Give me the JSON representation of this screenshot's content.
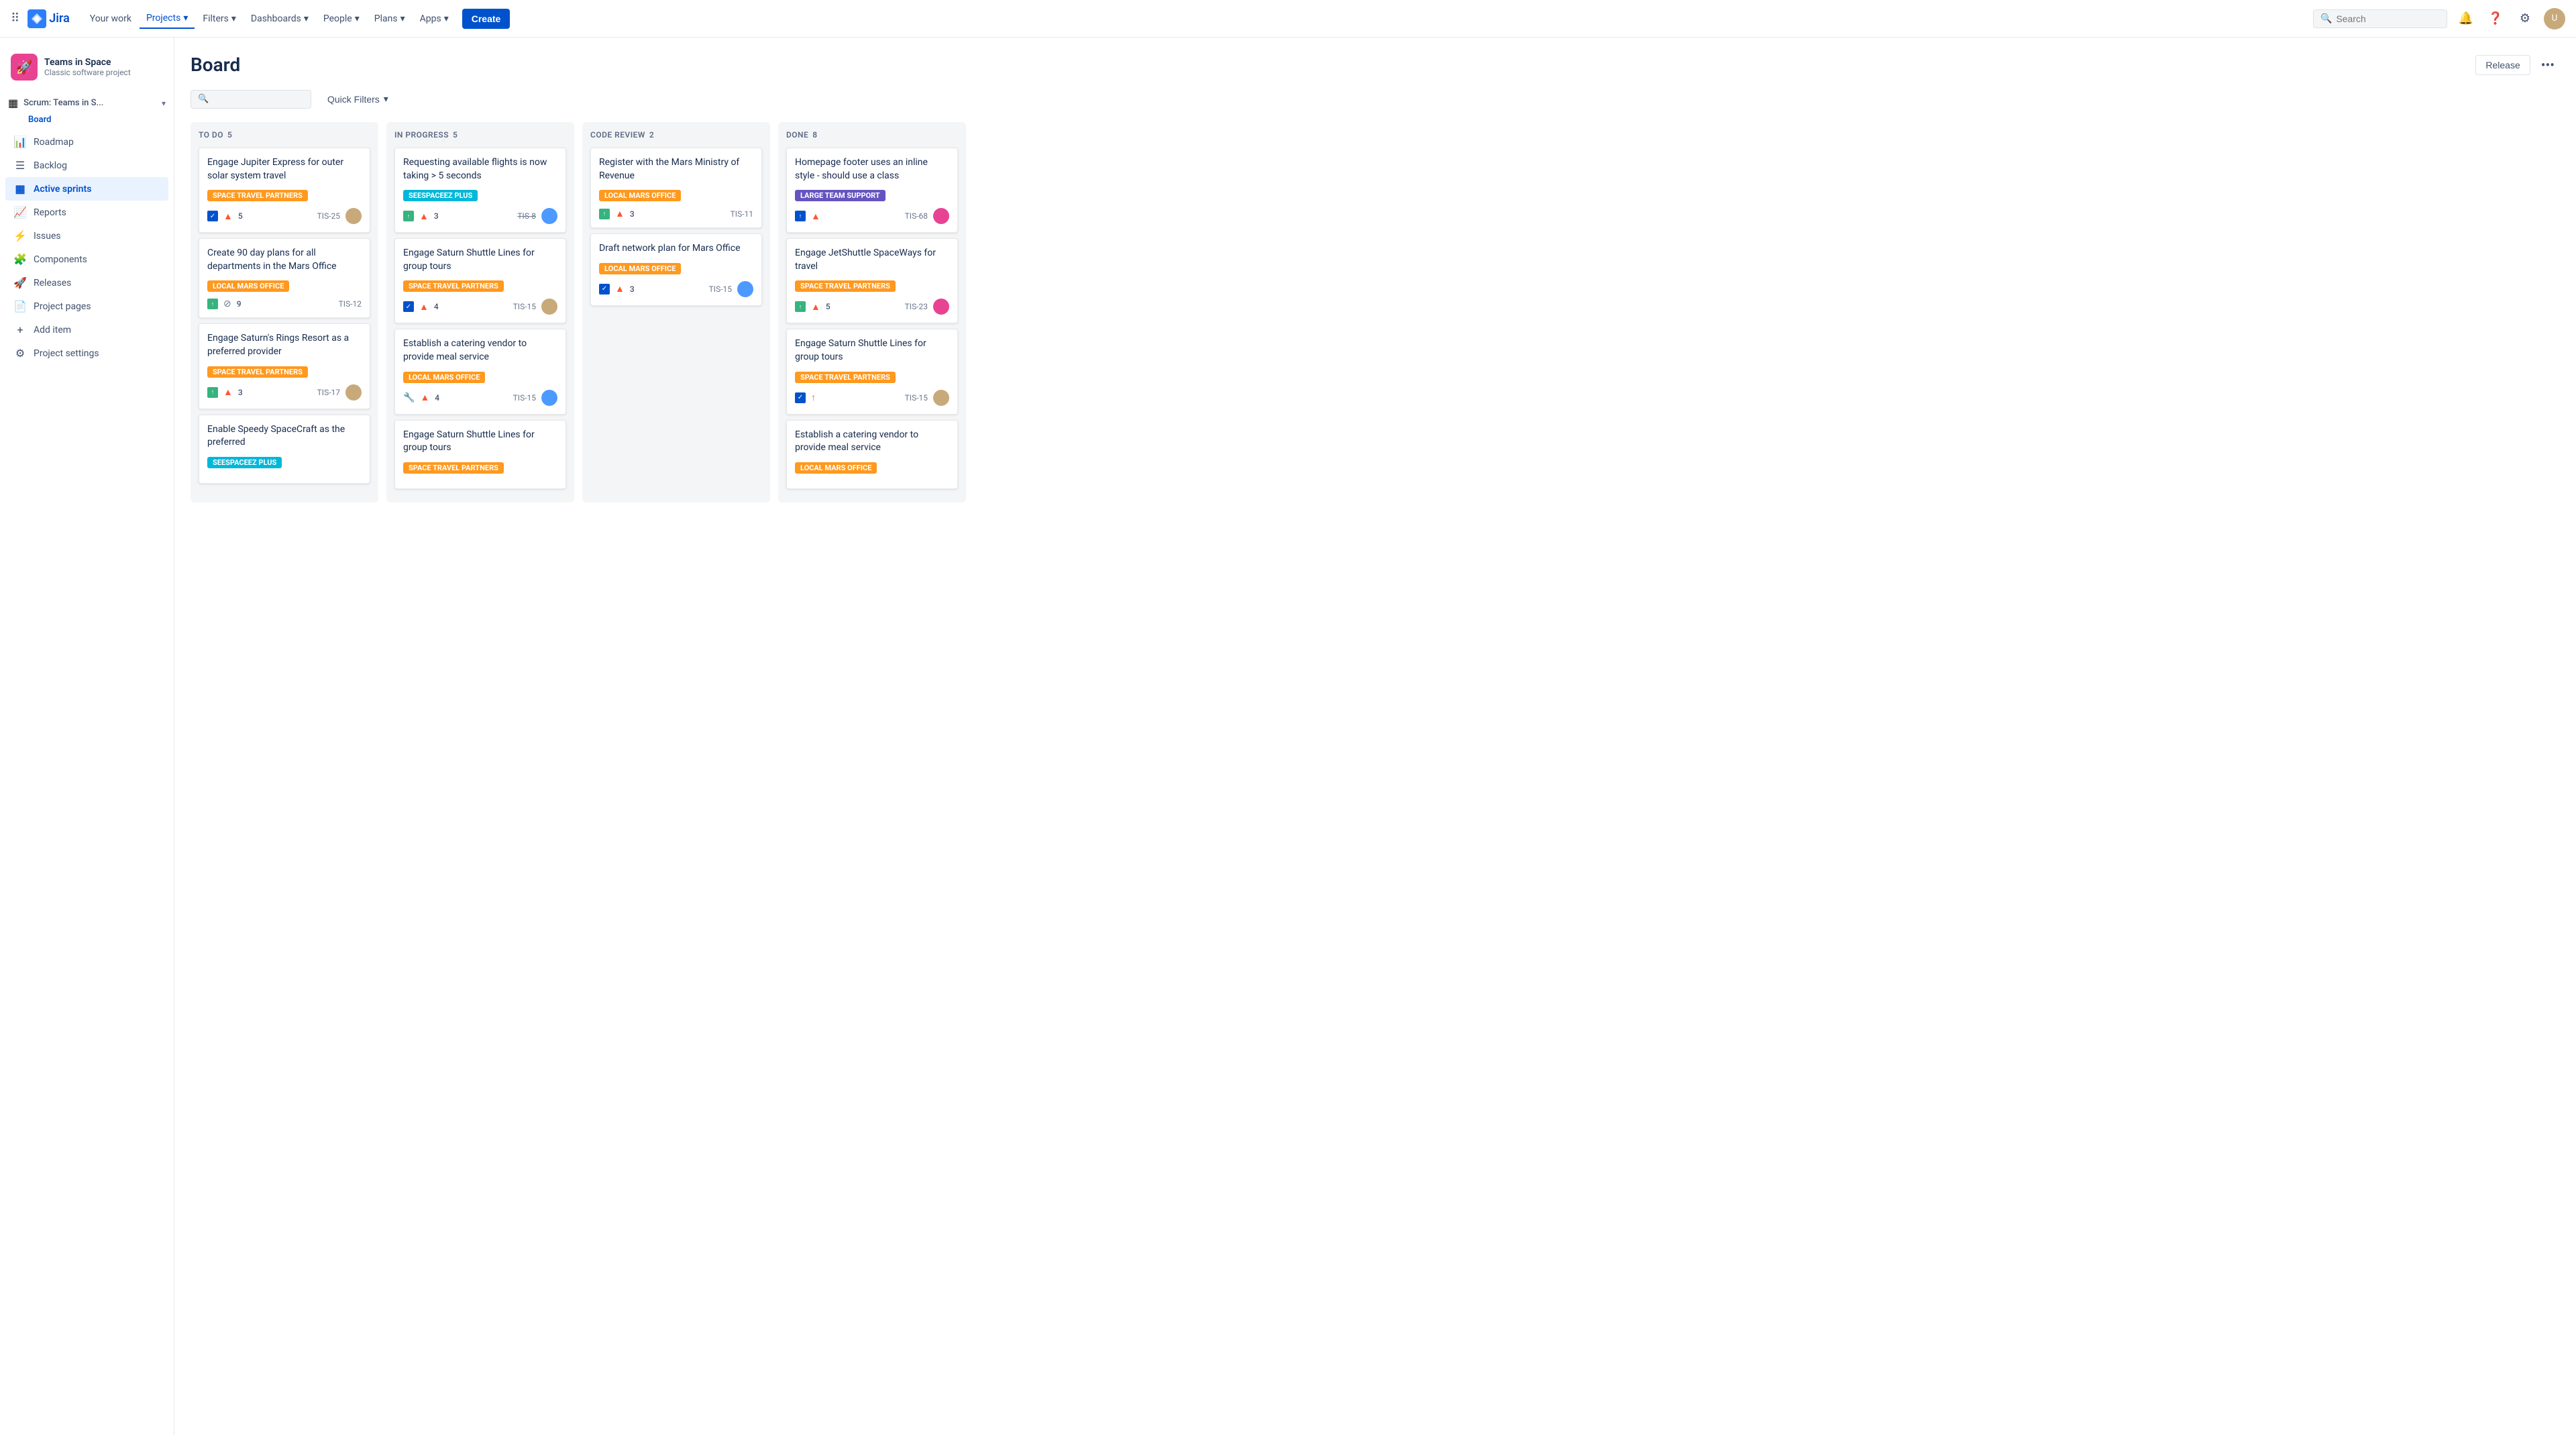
{
  "nav": {
    "logo_text": "Jira",
    "items": [
      {
        "label": "Your work",
        "active": false
      },
      {
        "label": "Projects",
        "active": true,
        "has_chevron": true
      },
      {
        "label": "Filters",
        "active": false,
        "has_chevron": true
      },
      {
        "label": "Dashboards",
        "active": false,
        "has_chevron": true
      },
      {
        "label": "People",
        "active": false,
        "has_chevron": true
      },
      {
        "label": "Plans",
        "active": false,
        "has_chevron": true
      },
      {
        "label": "Apps",
        "active": false,
        "has_chevron": true
      }
    ],
    "create_label": "Create",
    "search_placeholder": "Search"
  },
  "sidebar": {
    "project_name": "Teams in Space",
    "project_subtitle": "Classic software project",
    "board_label": "Scrum: Teams in S...",
    "board_sub": "Board",
    "items": [
      {
        "id": "roadmap",
        "label": "Roadmap",
        "icon": "📊"
      },
      {
        "id": "backlog",
        "label": "Backlog",
        "icon": "☰"
      },
      {
        "id": "active-sprints",
        "label": "Active sprints",
        "icon": "▦",
        "active": true
      },
      {
        "id": "reports",
        "label": "Reports",
        "icon": "📈"
      },
      {
        "id": "issues",
        "label": "Issues",
        "icon": "⚡"
      },
      {
        "id": "components",
        "label": "Components",
        "icon": "🧩"
      },
      {
        "id": "releases",
        "label": "Releases",
        "icon": "🚀"
      },
      {
        "id": "project-pages",
        "label": "Project pages",
        "icon": "📄"
      },
      {
        "id": "add-item",
        "label": "Add item",
        "icon": "+"
      },
      {
        "id": "project-settings",
        "label": "Project settings",
        "icon": "⚙"
      }
    ]
  },
  "board": {
    "title": "Board",
    "release_btn": "Release",
    "filters": {
      "quick_filters_label": "Quick Filters"
    },
    "columns": [
      {
        "id": "todo",
        "title": "TO DO",
        "count": 5,
        "cards": [
          {
            "title": "Engage Jupiter Express for outer solar system travel",
            "tag": "SPACE TRAVEL PARTNERS",
            "tag_color": "orange",
            "icon": "check",
            "priority": "high",
            "story_pts": "5",
            "ticket": "TIS-25",
            "avatar": "brown",
            "strikethrough": false
          },
          {
            "title": "Create 90 day plans for all departments in the Mars Office",
            "tag": "LOCAL MARS OFFICE",
            "tag_color": "orange",
            "icon": "story",
            "priority": "none",
            "story_pts": "9",
            "ticket": "TIS-12",
            "avatar": "",
            "has_no_entry": true,
            "strikethrough": false
          },
          {
            "title": "Engage Saturn's Rings Resort as a preferred provider",
            "tag": "SPACE TRAVEL PARTNERS",
            "tag_color": "orange",
            "icon": "story",
            "priority": "high",
            "story_pts": "3",
            "ticket": "TIS-17",
            "avatar": "brown2",
            "strikethrough": false
          },
          {
            "title": "Enable Speedy SpaceCraft as the preferred",
            "tag": "SEESPACEEZ PLUS",
            "tag_color": "teal",
            "icon": "",
            "priority": "",
            "story_pts": "",
            "ticket": "",
            "avatar": "",
            "strikethrough": false
          }
        ]
      },
      {
        "id": "inprogress",
        "title": "IN PROGRESS",
        "count": 5,
        "cards": [
          {
            "title": "Requesting available flights is now taking > 5 seconds",
            "tag": "SEESPACEEZ PLUS",
            "tag_color": "teal",
            "icon": "story",
            "priority": "high",
            "story_pts": "3",
            "ticket": "TIS-8",
            "ticket_strikethrough": true,
            "avatar": "brown3",
            "strikethrough": false
          },
          {
            "title": "Engage Saturn Shuttle Lines for group tours",
            "tag": "SPACE TRAVEL PARTNERS",
            "tag_color": "orange",
            "icon": "check",
            "priority": "high",
            "story_pts": "4",
            "ticket": "TIS-15",
            "avatar": "brown4",
            "strikethrough": false
          },
          {
            "title": "Establish a catering vendor to provide meal service",
            "tag": "LOCAL MARS OFFICE",
            "tag_color": "orange",
            "icon": "wrench",
            "priority": "high",
            "story_pts": "4",
            "ticket": "TIS-15",
            "avatar": "brown5",
            "strikethrough": false
          },
          {
            "title": "Engage Saturn Shuttle Lines for group tours",
            "tag": "SPACE TRAVEL PARTNERS",
            "tag_color": "orange",
            "icon": "",
            "priority": "",
            "story_pts": "",
            "ticket": "",
            "avatar": "",
            "strikethrough": false
          }
        ]
      },
      {
        "id": "codereview",
        "title": "CODE REVIEW",
        "count": 2,
        "cards": [
          {
            "title": "Register with the Mars Ministry of Revenue",
            "tag": "LOCAL MARS OFFICE",
            "tag_color": "orange",
            "icon": "story",
            "priority": "high",
            "story_pts": "3",
            "ticket": "TIS-11",
            "avatar": "",
            "strikethrough": false
          },
          {
            "title": "Draft network plan for Mars Office",
            "tag": "LOCAL MARS OFFICE",
            "tag_color": "orange",
            "icon": "check",
            "priority": "high",
            "story_pts": "3",
            "ticket": "TIS-15",
            "avatar": "brown6",
            "strikethrough": false
          }
        ]
      },
      {
        "id": "done",
        "title": "DONE",
        "count": 8,
        "cards": [
          {
            "title": "Homepage footer uses an inline style - should use a class",
            "tag": "LARGE TEAM SUPPORT",
            "tag_color": "purple",
            "icon": "story",
            "priority": "high",
            "story_pts": "",
            "ticket": "TIS-68",
            "avatar": "pink",
            "strikethrough": false
          },
          {
            "title": "Engage JetShuttle SpaceWays for travel",
            "tag": "SPACE TRAVEL PARTNERS",
            "tag_color": "orange",
            "icon": "story",
            "priority": "high",
            "story_pts": "5",
            "ticket": "TIS-23",
            "avatar": "pink2",
            "strikethrough": false
          },
          {
            "title": "Engage Saturn Shuttle Lines for group tours",
            "tag": "SPACE TRAVEL PARTNERS",
            "tag_color": "orange",
            "icon": "check",
            "priority": "up",
            "story_pts": "",
            "ticket": "TIS-15",
            "avatar": "brown7",
            "strikethrough": false
          },
          {
            "title": "Establish a catering vendor to provide meal service",
            "tag": "LOCAL MARS OFFICE",
            "tag_color": "orange",
            "icon": "",
            "priority": "",
            "story_pts": "",
            "ticket": "",
            "avatar": "",
            "strikethrough": false
          }
        ]
      }
    ]
  }
}
